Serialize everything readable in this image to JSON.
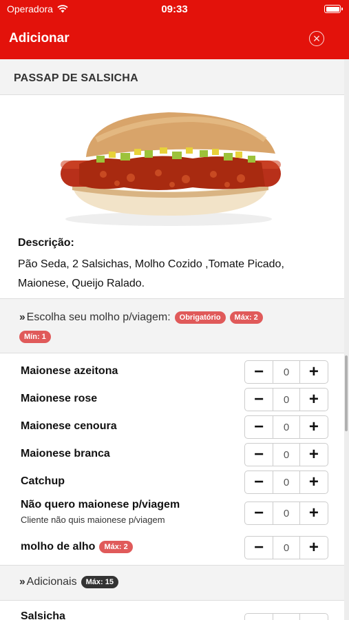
{
  "status": {
    "carrier": "Operadora",
    "time": "09:33"
  },
  "nav": {
    "title": "Adicionar",
    "close_icon": "close-circle-icon"
  },
  "product": {
    "title": "PASSAP DE SALSICHA",
    "image": "hotdog-image",
    "description_label": "Descrição:",
    "description": "Pão Seda, 2 Salsichas, Molho Cozido ,Tomate Picado, Maionese, Queijo Ralado."
  },
  "sauce_section": {
    "title": "Escolha seu molho p/viagem:",
    "badges": {
      "required": "Obrigatório",
      "max": "Máx: 2",
      "min": "Mín: 1"
    },
    "options": [
      {
        "label": "Maionese azeitona",
        "qty": "0"
      },
      {
        "label": "Maionese rose",
        "qty": "0"
      },
      {
        "label": "Maionese cenoura",
        "qty": "0"
      },
      {
        "label": "Maionese branca",
        "qty": "0"
      },
      {
        "label": "Catchup",
        "qty": "0"
      },
      {
        "label": "Não quero maionese p/viagem",
        "sub": "Cliente não quis maionese p/viagem",
        "qty": "0"
      },
      {
        "label": "molho de alho",
        "badge": "Máx: 2",
        "qty": "0"
      }
    ]
  },
  "extras_section": {
    "title": "Adicionais",
    "badge": "Máx: 15",
    "first_item": "Salsicha"
  },
  "stepper": {
    "minus": "−",
    "plus": "+"
  },
  "colors": {
    "brand": "#e3120b",
    "badge_red": "#e05a5a",
    "badge_dark": "#333333"
  }
}
